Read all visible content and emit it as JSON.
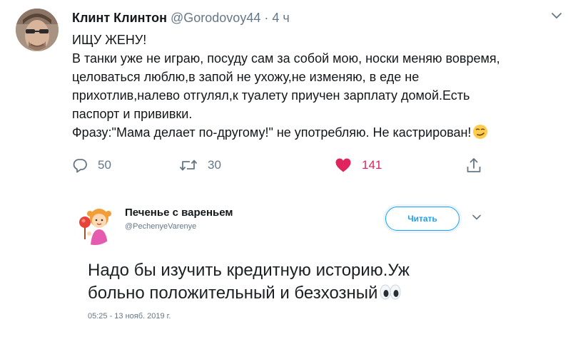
{
  "tweet": {
    "author": {
      "name": "Клинт Клинтон",
      "handle": "@Gorodovoy44",
      "separator": "·",
      "time": "4 ч"
    },
    "lines": [
      "ИЩУ ЖЕНУ!",
      "В танки уже не играю, посуду сам за собой мою, носки меняю вовремя,",
      "целоваться люблю,в запой не ухожу,не изменяю, в еде не",
      "прихотлив,налево отгулял,к туалету приучен зарплату домой.Есть",
      "паспорт и прививки.",
      "Фразу:\"Мама делает по-другому!\" не употребляю. Не кастрирован!"
    ],
    "last_line_emoji": "smirking-face-emoji",
    "actions": {
      "replies": "50",
      "retweets": "30",
      "likes": "141"
    },
    "colors": {
      "like": "#e0245e",
      "muted": "#657786",
      "text": "#14171a"
    }
  },
  "embedded": {
    "name": "Печенье с вареньем",
    "handle": "@PechenyeVarenye",
    "follow_label": "Читать",
    "text_lines": [
      "Надо бы изучить кредитную историю.Уж",
      "больно положительный и безхозный"
    ],
    "text_emoji": "eyes-emoji",
    "date": "05:25 - 13 нояб. 2019 г.",
    "colors": {
      "accent": "#1da1f2"
    }
  }
}
